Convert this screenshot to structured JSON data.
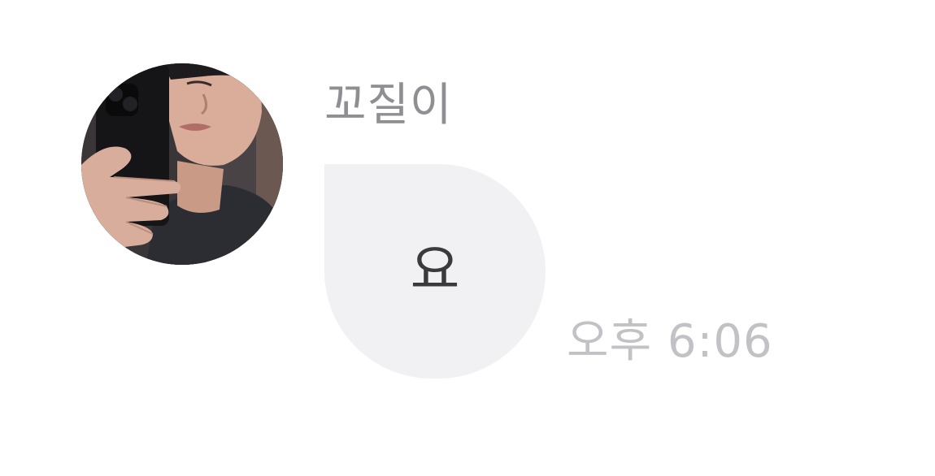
{
  "message": {
    "sender_name": "꼬질이",
    "text": "요",
    "time": "오후 6:06",
    "avatar_icon": "profile-photo"
  },
  "colors": {
    "bubble_bg": "#f1f1f3",
    "name_color": "#8e8e93",
    "time_color": "#c2c2c6",
    "message_text": "#3a3a3c",
    "background": "#ffffff"
  }
}
